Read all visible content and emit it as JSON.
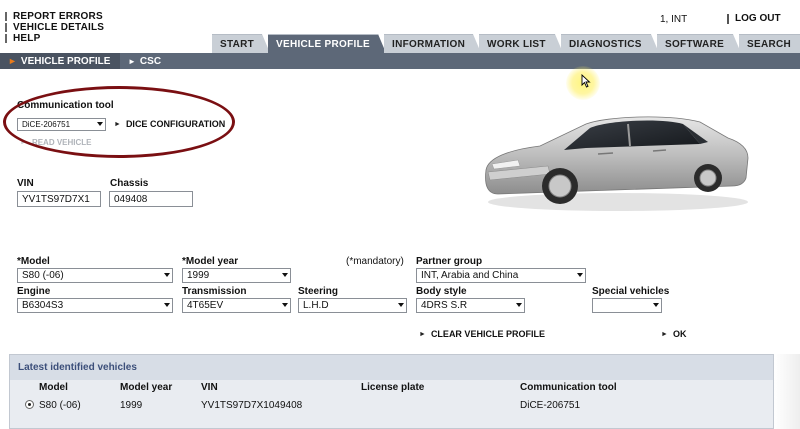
{
  "topmenu": {
    "items": [
      "REPORT ERRORS",
      "VEHICLE DETAILS",
      "HELP"
    ]
  },
  "user": {
    "info": "1, INT",
    "logout": "LOG OUT"
  },
  "tabs": [
    "START",
    "VEHICLE PROFILE",
    "INFORMATION",
    "WORK LIST",
    "DIAGNOSTICS",
    "SOFTWARE",
    "SEARCH"
  ],
  "active_tab": "VEHICLE PROFILE",
  "subnav": {
    "items": [
      "VEHICLE PROFILE",
      "CSC"
    ],
    "active": "VEHICLE PROFILE"
  },
  "comm": {
    "label": "Communication tool",
    "tool_value": "DiCE-206751",
    "dice_config": "DICE CONFIGURATION",
    "read_vehicle": "READ VEHICLE"
  },
  "ids": {
    "vin_label": "VIN",
    "vin_value": "YV1TS97D7X1",
    "chassis_label": "Chassis",
    "chassis_value": "049408"
  },
  "profile": {
    "mandatory_note": "(*mandatory)",
    "model_label": "*Model",
    "model_value": "S80 (-06)",
    "model_year_label": "*Model year",
    "model_year_value": "1999",
    "partner_group_label": "Partner group",
    "partner_group_value": "INT, Arabia and China",
    "engine_label": "Engine",
    "engine_value": "B6304S3",
    "transmission_label": "Transmission",
    "transmission_value": "4T65EV",
    "steering_label": "Steering",
    "steering_value": "L.H.D",
    "body_style_label": "Body style",
    "body_style_value": "4DRS S.R",
    "special_vehicles_label": "Special vehicles",
    "special_vehicles_value": ""
  },
  "actions": {
    "clear": "CLEAR VEHICLE PROFILE",
    "ok": "OK"
  },
  "latest": {
    "title": "Latest identified vehicles",
    "headers": [
      "Model",
      "Model year",
      "VIN",
      "License plate",
      "Communication tool"
    ],
    "rows": [
      [
        "S80 (-06)",
        "1999",
        "YV1TS97D7X1049408",
        "",
        "DiCE-206751"
      ]
    ]
  },
  "colors": {
    "tab_active": "#5d6878",
    "tab_inactive": "#c9cfd6",
    "highlight_ellipse": "#7a0f12",
    "panel_title": "#3c4f7a"
  }
}
